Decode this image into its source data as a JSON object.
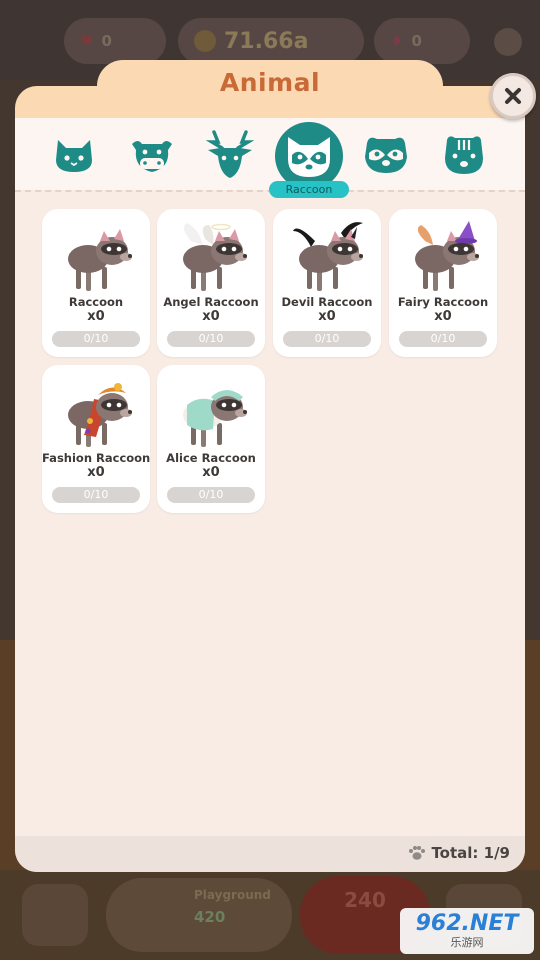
{
  "background": {
    "hearts": "0",
    "coins": "71.66a",
    "gems": "0",
    "playground_label": "Playground",
    "playground_value": "420",
    "red_button_value": "240"
  },
  "modal": {
    "title": "Animal",
    "categories": [
      {
        "icon": "cat-icon"
      },
      {
        "icon": "cow-icon"
      },
      {
        "icon": "deer-icon"
      },
      {
        "icon": "raccoon-icon",
        "label": "Raccoon",
        "active": true
      },
      {
        "icon": "red-panda-icon"
      },
      {
        "icon": "chipmunk-icon"
      }
    ],
    "active_category_label": "Raccoon",
    "animals": [
      {
        "name": "Raccoon",
        "count": "x0",
        "progress": "0/10",
        "progress_fraction": 0,
        "accessory": "none"
      },
      {
        "name": "Angel Raccoon",
        "count": "x0",
        "progress": "0/10",
        "progress_fraction": 0,
        "accessory": "wings"
      },
      {
        "name": "Devil Raccoon",
        "count": "x0",
        "progress": "0/10",
        "progress_fraction": 0,
        "accessory": "devil-wings"
      },
      {
        "name": "Fairy Raccoon",
        "count": "x0",
        "progress": "0/10",
        "progress_fraction": 0,
        "accessory": "witch-hat"
      },
      {
        "name": "Fashion Raccoon",
        "count": "x0",
        "progress": "0/10",
        "progress_fraction": 0,
        "accessory": "fashion-scarf"
      },
      {
        "name": "Alice Raccoon",
        "count": "x0",
        "progress": "0/10",
        "progress_fraction": 0,
        "accessory": "mint-hood"
      }
    ],
    "total": "Total: 1/9"
  },
  "watermark": {
    "top": "962.NET",
    "bottom": "乐游网"
  },
  "colors": {
    "accent_teal": "#1f8b86",
    "label_cyan": "#26c2c6",
    "title_orange": "#c86a37",
    "panel_peach": "#fbd9b3"
  }
}
